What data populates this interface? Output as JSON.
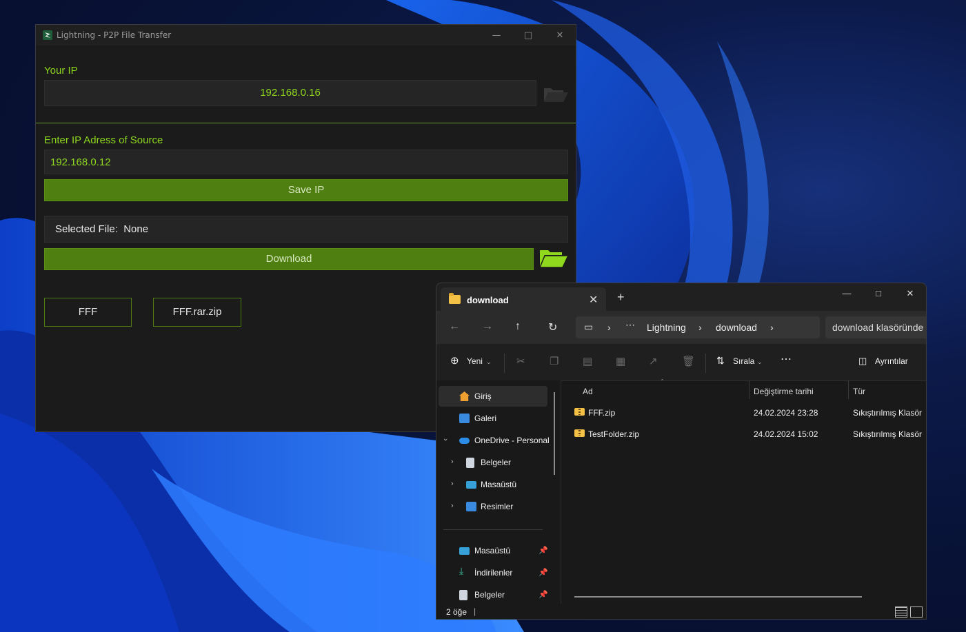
{
  "lightning": {
    "title": "Lightning - P2P File Transfer",
    "your_ip_label": "Your IP",
    "your_ip_value": "192.168.0.16",
    "source_label": "Enter IP Adress of Source",
    "source_value": "192.168.0.12",
    "save_ip_label": "Save IP",
    "selected_file_label": "Selected File:  None",
    "download_label": "Download",
    "files": [
      "FFF",
      "FFF.rar.zip"
    ],
    "accent_color": "#8fd81e",
    "button_color": "#4f7f10"
  },
  "explorer": {
    "tab_title": "download",
    "address": {
      "crumbs": [
        "Lightning",
        "download"
      ]
    },
    "search_placeholder": "download klasöründe",
    "toolbar": {
      "new_label": "Yeni",
      "sort_label": "Sırala",
      "details_label": "Ayrıntılar"
    },
    "nav": [
      {
        "label": "Giriş",
        "icon": "home-icon"
      },
      {
        "label": "Galeri",
        "icon": "gallery-icon"
      },
      {
        "label": "OneDrive - Personal",
        "icon": "onedrive-icon"
      },
      {
        "label": "Belgeler",
        "icon": "documents-icon"
      },
      {
        "label": "Masaüstü",
        "icon": "desktop-icon"
      },
      {
        "label": "Resimler",
        "icon": "pictures-icon"
      }
    ],
    "quick": [
      {
        "label": "Masaüstü",
        "icon": "desktop-icon"
      },
      {
        "label": "İndirilenler",
        "icon": "downloads-icon"
      },
      {
        "label": "Belgeler",
        "icon": "documents-icon"
      }
    ],
    "columns": {
      "name": "Ad",
      "modified": "Değiştirme tarihi",
      "type": "Tür"
    },
    "rows": [
      {
        "name": "FFF.zip",
        "modified": "24.02.2024 23:28",
        "type": "Sıkıştırılmış Klasör"
      },
      {
        "name": "TestFolder.zip",
        "modified": "24.02.2024 15:02",
        "type": "Sıkıştırılmış Klasör"
      }
    ],
    "status": "2 öğe"
  }
}
